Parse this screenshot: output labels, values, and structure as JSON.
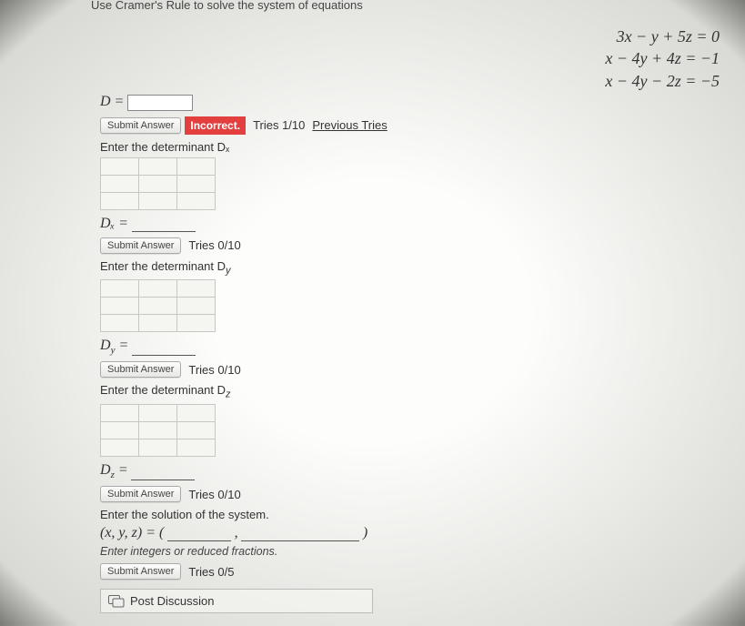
{
  "header": {
    "title": "Use Cramer's Rule to solve the system of equations"
  },
  "equations": {
    "eq1": "3x − y + 5z = 0",
    "eq2": "x − 4y + 4z = −1",
    "eq3": "x − 4y − 2z = −5"
  },
  "partD": {
    "label_prefix": "D =",
    "submit": "Submit Answer",
    "status": "Incorrect.",
    "tries": "Tries 1/10",
    "prev_link": "Previous Tries"
  },
  "partDx": {
    "instr": "Enter the determinant Dₓ",
    "answer_label": "Dₓ =",
    "submit": "Submit Answer",
    "tries": "Tries 0/10"
  },
  "partDy": {
    "instr": "Enter the determinant D",
    "instr_sub": "y",
    "answer_label": "D",
    "answer_sub": "y",
    "eq": " =",
    "submit": "Submit Answer",
    "tries": "Tries 0/10"
  },
  "partDz": {
    "instr": "Enter the determinant D",
    "instr_sub": "z",
    "answer_label": "D",
    "answer_sub": "z",
    "eq": " =",
    "submit": "Submit Answer",
    "tries": "Tries 0/10"
  },
  "solution": {
    "instr": "Enter the solution of the system.",
    "tuple_open": "(x, y, z) = (",
    "comma": ",",
    "close": ")",
    "hint": "Enter integers or reduced fractions.",
    "submit": "Submit Answer",
    "tries": "Tries 0/5"
  },
  "footer": {
    "post": "Post Discussion"
  }
}
